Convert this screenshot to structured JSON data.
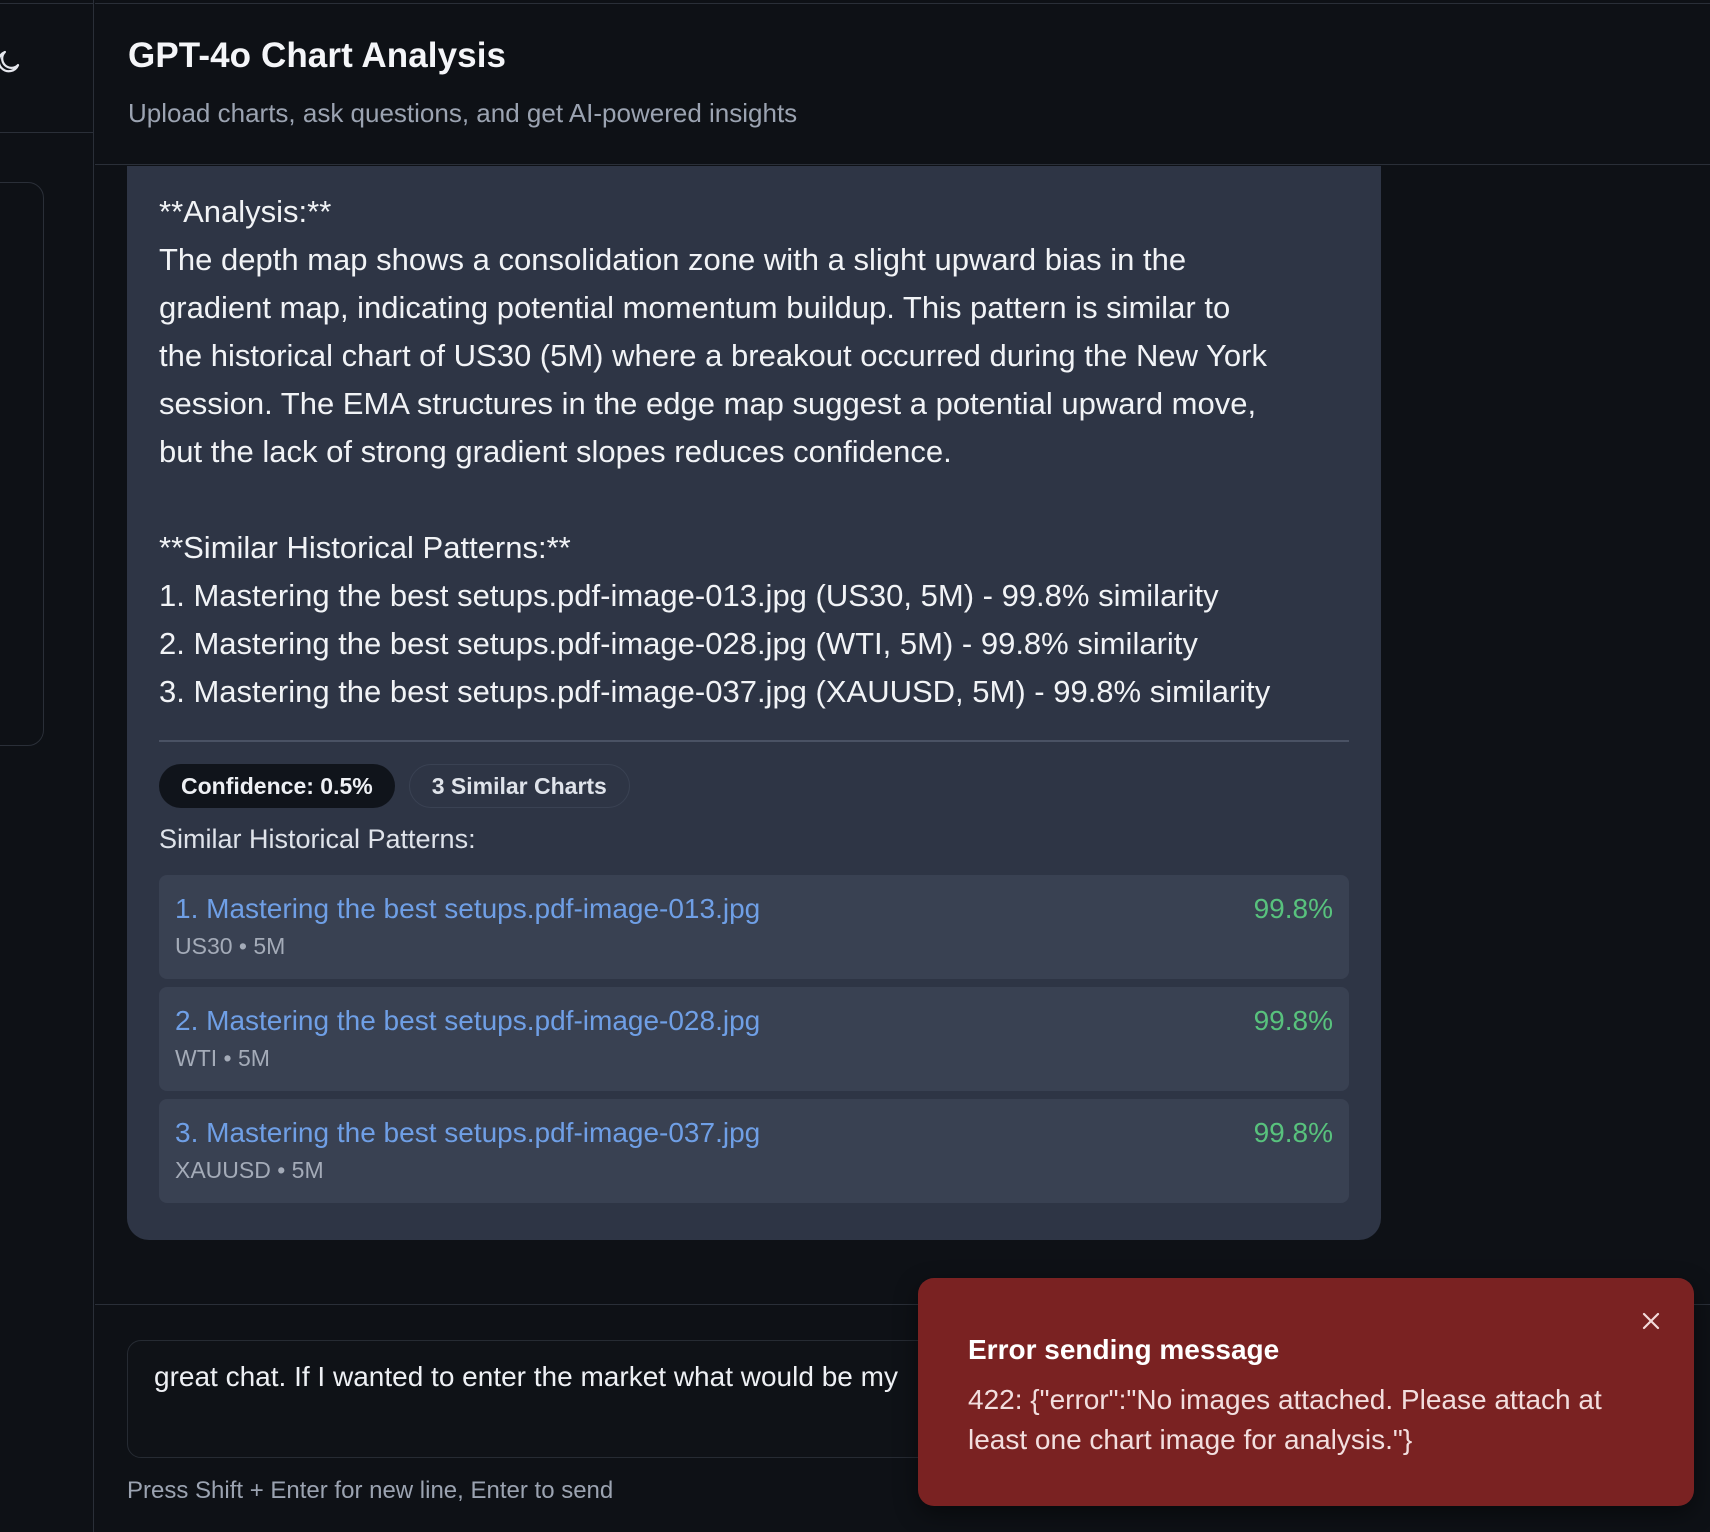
{
  "header": {
    "title": "GPT-4o Chart Analysis",
    "subtitle": "Upload charts, ask questions, and get AI-powered insights"
  },
  "message": {
    "lines": [
      "**Analysis:**",
      "The depth map shows a consolidation zone with a slight upward bias in the",
      "gradient map, indicating potential momentum buildup. This pattern is similar to",
      "the historical chart of US30 (5M) where a breakout occurred during the New York",
      "session. The EMA structures in the edge map suggest a potential upward move,",
      "but the lack of strong gradient slopes reduces confidence.",
      "",
      "**Similar Historical Patterns:**",
      "1. Mastering the best setups.pdf-image-013.jpg (US30, 5M) - 99.8% similarity",
      "2. Mastering the best setups.pdf-image-028.jpg (WTI, 5M) - 99.8% similarity",
      "3. Mastering the best setups.pdf-image-037.jpg (XAUUSD, 5M) - 99.8% similarity"
    ],
    "confidence_badge": "Confidence: 0.5%",
    "similar_count_badge": "3 Similar Charts",
    "similar_heading": "Similar Historical Patterns:",
    "similar_items": [
      {
        "title": "1. Mastering the best setups.pdf-image-013.jpg",
        "meta": "US30 • 5M",
        "score": "99.8%"
      },
      {
        "title": "2. Mastering the best setups.pdf-image-028.jpg",
        "meta": "WTI • 5M",
        "score": "99.8%"
      },
      {
        "title": "3. Mastering the best setups.pdf-image-037.jpg",
        "meta": "XAUUSD • 5M",
        "score": "99.8%"
      }
    ]
  },
  "composer": {
    "value": "great chat. If I wanted to enter the market what would be my",
    "hint": "Press Shift + Enter for new line, Enter to send"
  },
  "toast": {
    "title": "Error sending message",
    "body": "422: {\"error\":\"No images attached. Please attach at least one chart image for analysis.\"}"
  },
  "colors": {
    "background": "#0e1116",
    "card": "#2e3545",
    "item": "#394152",
    "link": "#6f9fe6",
    "score": "#58c27d",
    "error": "#7a2222"
  },
  "icons": {
    "theme_toggle": "moon-icon",
    "toast_close": "close-icon"
  }
}
